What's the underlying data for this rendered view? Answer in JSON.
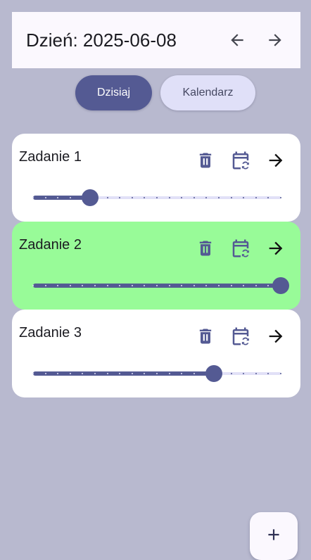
{
  "header": {
    "title": "Dzień: 2025-06-08",
    "prev_icon": "arrow-left-icon",
    "next_icon": "arrow-right-icon"
  },
  "view_toggle": {
    "today_label": "Dzisiaj",
    "calendar_label": "Kalendarz",
    "selected": "Dzisiaj"
  },
  "tasks": [
    {
      "title": "Zadanie 1",
      "progress": 0.23,
      "background": "#ffffff",
      "completed": false
    },
    {
      "title": "Zadanie 2",
      "progress": 1.0,
      "background": "#98fb98",
      "completed": true
    },
    {
      "title": "Zadanie 3",
      "progress": 0.73,
      "background": "#ffffff",
      "completed": false
    }
  ],
  "task_actions": {
    "delete_icon": "trash-icon",
    "reschedule_icon": "calendar-sync-icon",
    "open_icon": "arrow-right-icon"
  },
  "fab": {
    "icon": "plus-icon"
  },
  "colors": {
    "background": "#b8b9cf",
    "accent": "#545a93",
    "accent_container": "#e0e0f8",
    "surface": "#fbf8fe",
    "completed": "#98fb98"
  }
}
